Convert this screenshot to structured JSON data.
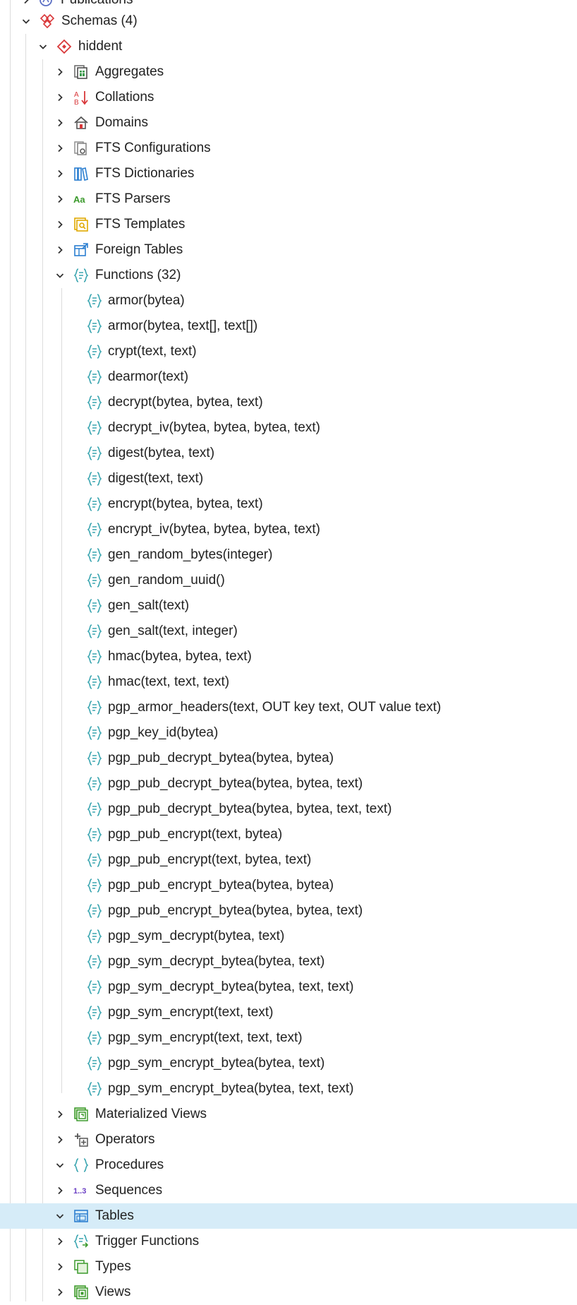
{
  "tree": {
    "partial_top_label": "Publications",
    "schemas": {
      "label": "Schemas (4)",
      "expanded": true
    },
    "schema": {
      "label": "hiddent",
      "expanded": true
    },
    "collections": [
      {
        "label": "Aggregates",
        "icon": "aggregates-icon",
        "expanded": false
      },
      {
        "label": "Collations",
        "icon": "collations-icon",
        "expanded": false
      },
      {
        "label": "Domains",
        "icon": "domains-icon",
        "expanded": false
      },
      {
        "label": "FTS Configurations",
        "icon": "fts-configurations-icon",
        "expanded": false
      },
      {
        "label": "FTS Dictionaries",
        "icon": "fts-dictionaries-icon",
        "expanded": false
      },
      {
        "label": "FTS Parsers",
        "icon": "fts-parsers-icon",
        "icon_text": "Aa",
        "expanded": false
      },
      {
        "label": "FTS Templates",
        "icon": "fts-templates-icon",
        "expanded": false
      },
      {
        "label": "Foreign Tables",
        "icon": "foreign-tables-icon",
        "expanded": false
      },
      {
        "label": "Functions (32)",
        "icon": "functions-icon",
        "expanded": true
      }
    ],
    "functions": [
      "armor(bytea)",
      "armor(bytea, text[], text[])",
      "crypt(text, text)",
      "dearmor(text)",
      "decrypt(bytea, bytea, text)",
      "decrypt_iv(bytea, bytea, bytea, text)",
      "digest(bytea, text)",
      "digest(text, text)",
      "encrypt(bytea, bytea, text)",
      "encrypt_iv(bytea, bytea, bytea, text)",
      "gen_random_bytes(integer)",
      "gen_random_uuid()",
      "gen_salt(text)",
      "gen_salt(text, integer)",
      "hmac(bytea, bytea, text)",
      "hmac(text, text, text)",
      "pgp_armor_headers(text, OUT key text, OUT value text)",
      "pgp_key_id(bytea)",
      "pgp_pub_decrypt_bytea(bytea, bytea)",
      "pgp_pub_decrypt_bytea(bytea, bytea, text)",
      "pgp_pub_decrypt_bytea(bytea, bytea, text, text)",
      "pgp_pub_encrypt(text, bytea)",
      "pgp_pub_encrypt(text, bytea, text)",
      "pgp_pub_encrypt_bytea(bytea, bytea)",
      "pgp_pub_encrypt_bytea(bytea, bytea, text)",
      "pgp_sym_decrypt(bytea, text)",
      "pgp_sym_decrypt_bytea(bytea, text)",
      "pgp_sym_decrypt_bytea(bytea, text, text)",
      "pgp_sym_encrypt(text, text)",
      "pgp_sym_encrypt(text, text, text)",
      "pgp_sym_encrypt_bytea(bytea, text)",
      "pgp_sym_encrypt_bytea(bytea, text, text)"
    ],
    "collections_after": [
      {
        "label": "Materialized Views",
        "icon": "materialized-views-icon",
        "expanded": false,
        "selected": false
      },
      {
        "label": "Operators",
        "icon": "operators-icon",
        "expanded": false,
        "selected": false
      },
      {
        "label": "Procedures",
        "icon": "procedures-icon",
        "expanded": true,
        "selected": false
      },
      {
        "label": "Sequences",
        "icon": "sequences-icon",
        "icon_text": "1..3",
        "expanded": false,
        "selected": false
      },
      {
        "label": "Tables",
        "icon": "tables-icon",
        "expanded": true,
        "selected": true
      },
      {
        "label": "Trigger Functions",
        "icon": "trigger-functions-icon",
        "expanded": false,
        "selected": false
      },
      {
        "label": "Types",
        "icon": "types-icon",
        "expanded": false,
        "selected": false
      },
      {
        "label": "Views",
        "icon": "views-icon",
        "expanded": false,
        "selected": false
      }
    ]
  },
  "colors": {
    "selected_row": "#d6ecf8",
    "function_icon": "#3aa5b0",
    "schema_icon": "#d9383a",
    "guide_line": "#dcdcdc"
  }
}
